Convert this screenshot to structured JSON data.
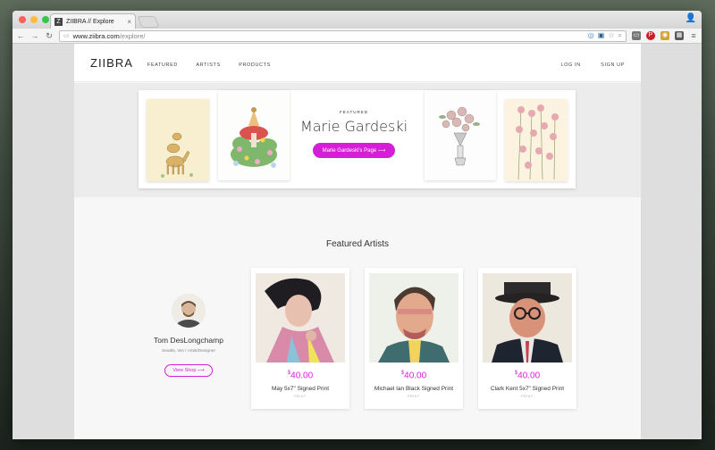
{
  "browser": {
    "tab_title": "ZIIBRA // Explore",
    "tab_favicon": "Z",
    "url_host": "www.ziibra.com",
    "url_path": "/explore/"
  },
  "site": {
    "logo": "ZIIBRA",
    "nav": [
      "FEATURED",
      "ARTISTS",
      "PRODUCTS"
    ],
    "login": "LOG IN",
    "signup": "SIGN UP",
    "accent_color": "#d61ed8"
  },
  "hero": {
    "label": "FEATURED",
    "name": "Marie Gardeski",
    "button": "Marie Gardeski's Page ⟶"
  },
  "featured_artists": {
    "title": "Featured Artists",
    "artist_name": "Tom DesLongchamp",
    "artist_location": "Seattle, WA  /  Artist/Designer",
    "view_shop": "View Shop ⟶",
    "products": [
      {
        "currency": "$",
        "price": "40.00",
        "name": "May 5x7\" Signed Print",
        "type": "PRINT"
      },
      {
        "currency": "$",
        "price": "40.00",
        "name": "Michael Ian Black Signed Print",
        "type": "PRINT"
      },
      {
        "currency": "$",
        "price": "40.00",
        "name": "Clark Kent 5x7\" Signed Print",
        "type": "PRINT"
      }
    ]
  }
}
